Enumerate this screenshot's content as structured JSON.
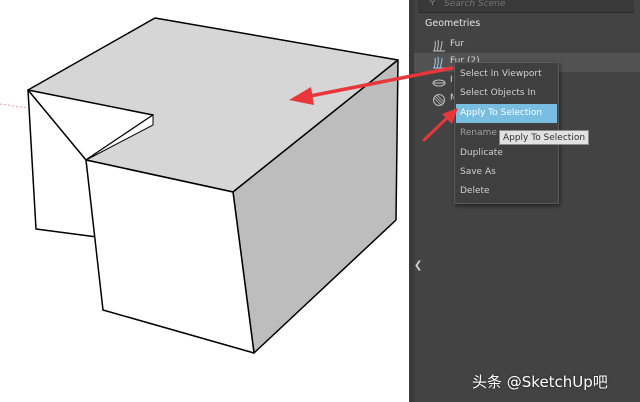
{
  "search": {
    "placeholder": "Search Scene",
    "icon": "search-icon"
  },
  "geometries": {
    "title": "Geometries",
    "items": [
      {
        "label": "Fur",
        "icon": "fur-icon"
      },
      {
        "label": "Fur (2)",
        "icon": "fur-icon"
      },
      {
        "label": "I",
        "icon": "infinite-plane-icon"
      },
      {
        "label": "M",
        "icon": "mesh-icon"
      }
    ]
  },
  "context_menu": {
    "items": [
      {
        "label": "Select In Viewport",
        "state": "normal"
      },
      {
        "label": "Select Objects In Scene",
        "state": "normal"
      },
      {
        "label": "Apply To Selection",
        "state": "highlighted"
      },
      {
        "label": "Rename",
        "state": "disabled"
      },
      {
        "label": "Duplicate",
        "state": "normal"
      },
      {
        "label": "Save As",
        "state": "normal"
      },
      {
        "label": "Delete",
        "state": "normal"
      }
    ]
  },
  "tooltip": "Apply To Selection",
  "watermark": "头条 @SketchUp吧",
  "colors": {
    "panel_bg": "#434343",
    "highlight": "#79bde0",
    "arrow": "#e8373a",
    "top_face": "#d6d6d6",
    "side_face": "#bdbdbd"
  }
}
